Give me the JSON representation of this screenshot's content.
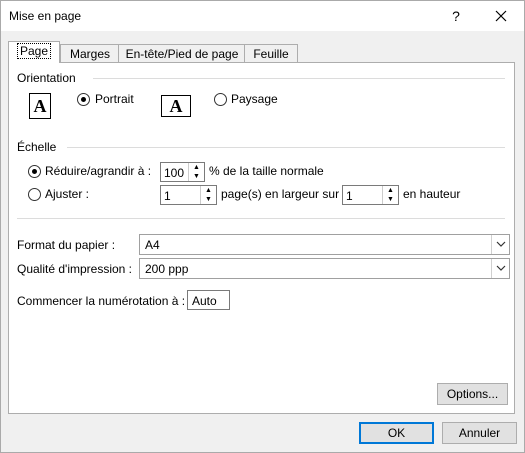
{
  "window": {
    "title": "Mise en page",
    "help": "?",
    "close": "✕"
  },
  "tabs": [
    {
      "label": "Page"
    },
    {
      "label": "Marges"
    },
    {
      "label": "En-tête/Pied de page"
    },
    {
      "label": "Feuille"
    }
  ],
  "orientation": {
    "label": "Orientation",
    "portrait_label": "Portrait",
    "landscape_label": "Paysage",
    "portrait_icon_glyph": "A",
    "landscape_icon_glyph": "A",
    "selected": "portrait"
  },
  "scale": {
    "label": "Échelle",
    "reduce_label": "Réduire/agrandir à :",
    "reduce_value": "100",
    "reduce_suffix": "% de la taille normale",
    "fit_label": "Ajuster :",
    "fit_width_value": "1",
    "fit_width_suffix": "page(s) en largeur sur",
    "fit_height_value": "1",
    "fit_height_suffix": "en hauteur",
    "selected": "reduce"
  },
  "paper": {
    "size_label": "Format du papier :",
    "size_value": "A4",
    "quality_label": "Qualité d'impression :",
    "quality_value": "200 ppp",
    "first_page_label": "Commencer la numérotation à :",
    "first_page_value": "Auto"
  },
  "buttons": {
    "options": "Options...",
    "ok": "OK",
    "cancel": "Annuler"
  }
}
